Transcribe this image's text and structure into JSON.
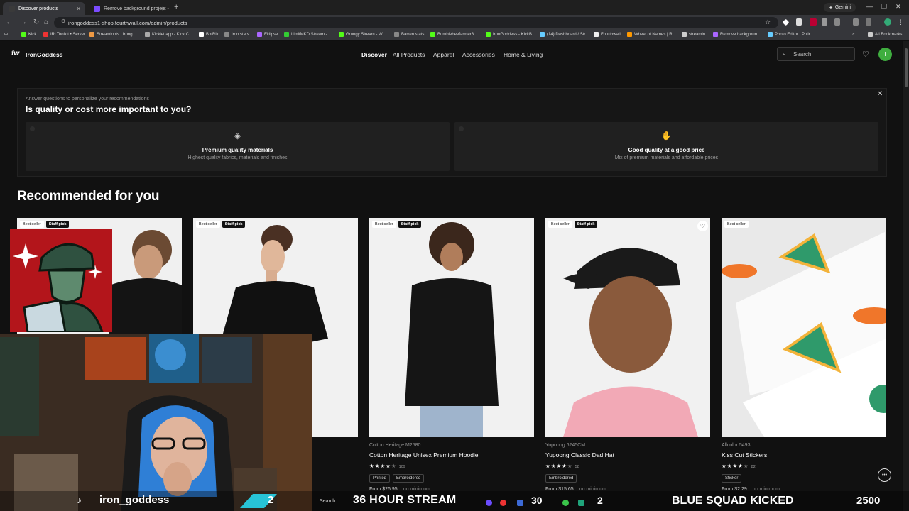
{
  "browser": {
    "tabs": [
      {
        "title": "Discover products",
        "favicon_color": "#2a2a2a"
      },
      {
        "title": "Remove background project -",
        "favicon_color": "#7b4cff"
      }
    ],
    "gemini_label": "Gemini",
    "url": "irongoddess1-shop.fourthwall.com/admin/products",
    "bookmarks": [
      {
        "label": "Kick",
        "color": "#53fc18"
      },
      {
        "label": "IRLToolkit • Server",
        "color": "#e33"
      },
      {
        "label": "Streamloots | Irong...",
        "color": "#e94"
      },
      {
        "label": "Kicklet.app - Kick C...",
        "color": "#aaa"
      },
      {
        "label": "BotRix",
        "color": "#fff"
      },
      {
        "label": "Iron stats",
        "color": "#888"
      },
      {
        "label": "Eklipse",
        "color": "#a6f"
      },
      {
        "label": "LimitMKD Stream -...",
        "color": "#3c3"
      },
      {
        "label": "Grungy Stream - W...",
        "color": "#53fc18"
      },
      {
        "label": "Barren stats",
        "color": "#888"
      },
      {
        "label": "Bumblebeefarmer8...",
        "color": "#53fc18"
      },
      {
        "label": "IronGoddess - KickB...",
        "color": "#53fc18"
      },
      {
        "label": "(14) Dashboard / Str...",
        "color": "#6cf"
      },
      {
        "label": "Fourthwall",
        "color": "#eee"
      },
      {
        "label": "Wheel of Names | R...",
        "color": "#f90"
      },
      {
        "label": "streamin",
        "color": "#ccc"
      },
      {
        "label": "Remove backgroun...",
        "color": "#a6f"
      },
      {
        "label": "Photo Editor : Pixlr...",
        "color": "#6cf"
      }
    ],
    "all_bookmarks": "All Bookmarks"
  },
  "site": {
    "logo": "fw",
    "brand": "IronGoddess",
    "nav": [
      "Discover",
      "All Products",
      "Apparel",
      "Accessories",
      "Home & Living"
    ],
    "search_placeholder": "Search",
    "avatar_letter": "I",
    "quiz": {
      "hint": "Answer questions to personalize your recommendations",
      "question": "Is quality or cost more important to you?",
      "options": [
        {
          "title": "Premium quality materials",
          "desc": "Highest quality fabrics, materials and finishes",
          "icon": "diamond-icon"
        },
        {
          "title": "Good quality at a good price",
          "desc": "Mix of premium materials and affordable prices",
          "icon": "hand-coin-icon"
        }
      ]
    },
    "section_title": "Recommended for you",
    "products": [
      {
        "badges": [
          "Best seller",
          "Staff pick"
        ],
        "brand": "",
        "name": "",
        "rating": 0,
        "count": "",
        "tags": [],
        "price": "",
        "min": ""
      },
      {
        "badges": [
          "Best seller",
          "Staff pick"
        ],
        "brand": "",
        "name": "",
        "rating": 0,
        "count": "",
        "tags": [],
        "price": "",
        "min": ""
      },
      {
        "badges": [
          "Best seller",
          "Staff pick"
        ],
        "brand": "Cotton Heritage M2580",
        "name": "Cotton Heritage Unisex Premium Hoodie",
        "rating": 4.5,
        "count": "109",
        "tags": [
          "Printed",
          "Embroidered"
        ],
        "price": "From $26.95",
        "min": "no minimum"
      },
      {
        "badges": [
          "Best seller",
          "Staff pick"
        ],
        "brand": "Yupoong 6245CM",
        "name": "Yupoong Classic Dad Hat",
        "rating": 4.5,
        "count": "58",
        "tags": [
          "Embroidered"
        ],
        "price": "From $15.65",
        "min": "no minimum"
      },
      {
        "badges": [
          "Best seller"
        ],
        "brand": "Allcolor 5493",
        "name": "Kiss Cut Stickers",
        "rating": 4.5,
        "count": "82",
        "tags": [
          "Sticker"
        ],
        "price": "From $2.29",
        "min": "no minimum"
      }
    ]
  },
  "stream": {
    "handle": "iron_goddess",
    "sub_count": "2",
    "banner": "36 HOUR STREAM",
    "counter_a": "30",
    "counter_b": "2",
    "kick_text": "BLUE SQUAD KICKED",
    "points": "2500",
    "taskbar_search": "Search"
  }
}
